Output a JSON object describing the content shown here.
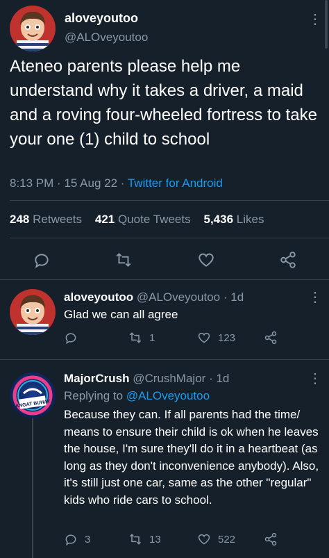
{
  "main_tweet": {
    "display_name": "aloveyoutoo",
    "handle": "@ALOveyoutoo",
    "text": "Ateneo parents please help me understand why it takes a driver, a maid and a roving four-wheeled fortress to take your one (1) child to school",
    "time": "8:13 PM",
    "date": "15 Aug 22",
    "separator": "·",
    "source": "Twitter for Android",
    "retweets_count": "248",
    "retweets_label": "Retweets",
    "quotes_count": "421",
    "quotes_label": "Quote Tweets",
    "likes_count": "5,436",
    "likes_label": "Likes"
  },
  "replies": [
    {
      "display_name": "aloveyoutoo",
      "handle": "@ALOveyoutoo",
      "age": "· 1d",
      "text": "Glad we can all agree",
      "replies_count": "",
      "retweets_count": "1",
      "likes_count": "123"
    },
    {
      "display_name": "MajorCrush",
      "handle": "@CrushMajor",
      "age": "· 1d",
      "replying_to_label": "Replying to",
      "replying_to_handle": "@ALOveyoutoo",
      "text": "Because they can. If all parents had the time/ means to ensure their child is ok when he leaves the house, I'm sure they'll do it in a heartbeat (as long as they don't inconvenience anybody). Also, it's still just one car, same as the other \"regular\" kids who ride cars to school.",
      "replies_count": "3",
      "retweets_count": "13",
      "likes_count": "522",
      "avatar_text": "ANGAT BUHAY"
    }
  ],
  "colors": {
    "background": "#15202b",
    "muted": "#8b98a5",
    "accent": "#1d9bf0",
    "divider": "#38444d"
  },
  "icons": [
    "more-icon",
    "reply-icon",
    "retweet-icon",
    "like-icon",
    "share-icon"
  ]
}
